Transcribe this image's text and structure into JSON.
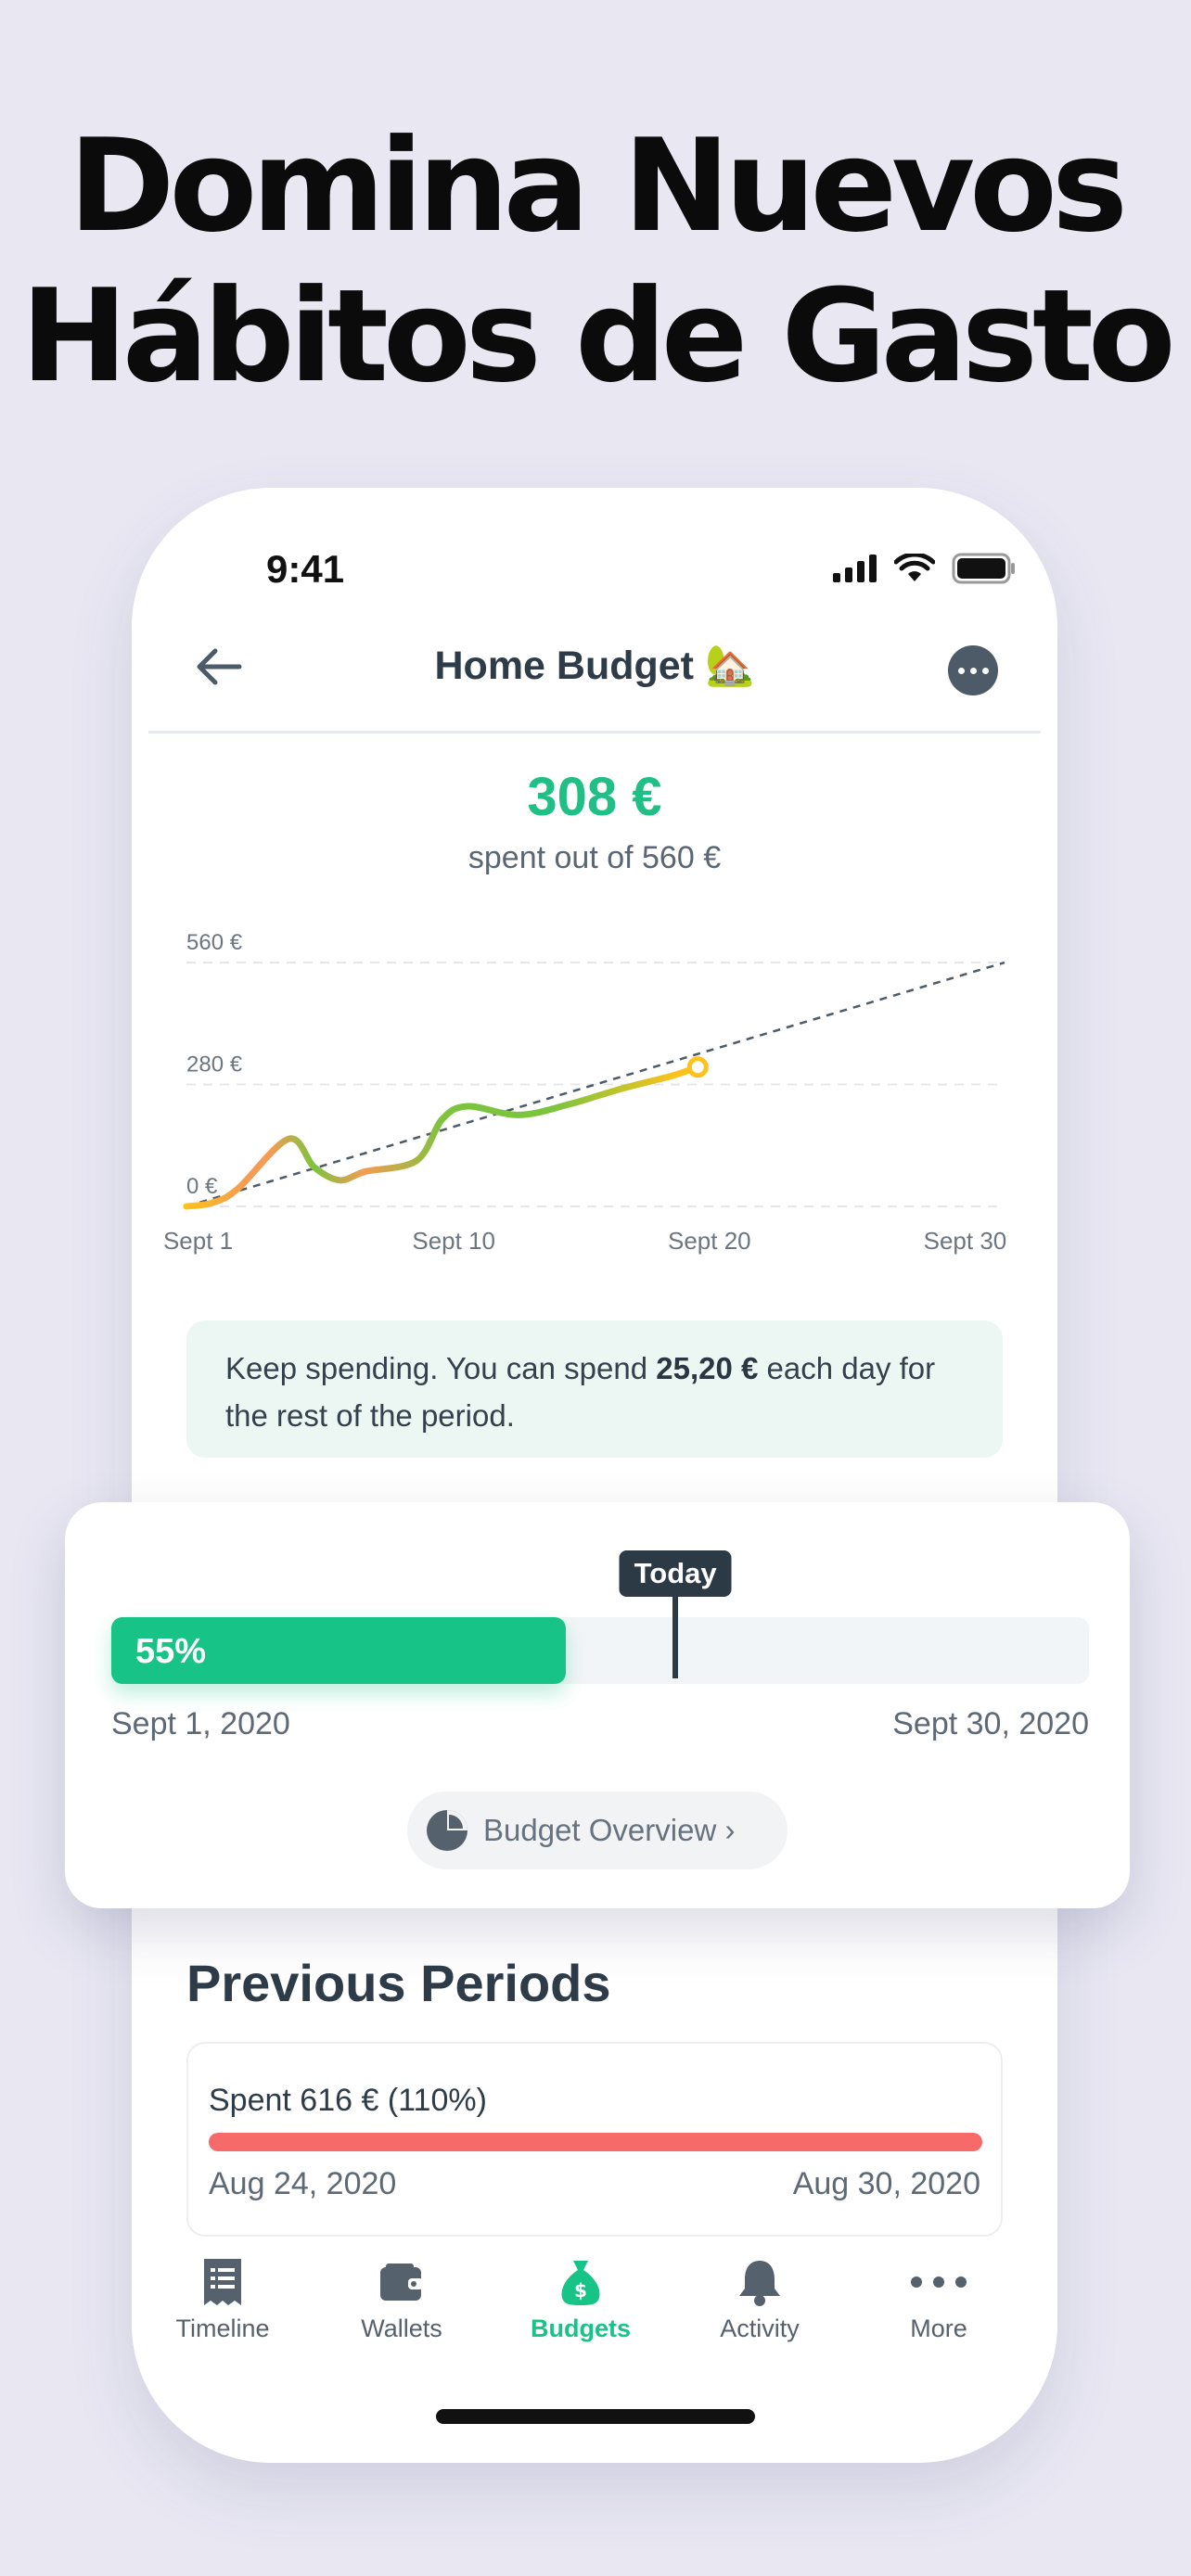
{
  "headline": {
    "line1": "Domina Nuevos",
    "line2": "Hábitos de Gasto"
  },
  "status": {
    "time": "9:41"
  },
  "nav": {
    "title": "Home Budget 🏡"
  },
  "budget": {
    "spent": "308 €",
    "subtitle": "spent out of 560 €"
  },
  "chart_data": {
    "type": "line",
    "y_tick_labels": [
      "560 €",
      "280 €",
      "0 €"
    ],
    "x_tick_labels": [
      "Sept 1",
      "Sept 10",
      "Sept 20",
      "Sept 30"
    ],
    "ylim": [
      0,
      560
    ],
    "xlim": [
      0,
      32
    ],
    "grid": true,
    "series": [
      {
        "x": [
          0,
          1,
          2,
          4,
          5,
          6,
          7,
          9,
          10,
          11,
          13,
          15,
          17,
          19,
          20
        ],
        "y": [
          0,
          8,
          40,
          155,
          90,
          60,
          80,
          105,
          200,
          230,
          210,
          235,
          270,
          300,
          320
        ]
      },
      {
        "x": [
          0,
          32
        ],
        "y": [
          0,
          560
        ]
      }
    ],
    "today_x": 20,
    "colors": {
      "line_start": "#FFC21A",
      "line_mid": "#F59B52",
      "line_good": "#7CC43E",
      "target": "#4d5b69"
    }
  },
  "tip": {
    "prefix": "Keep spending. You can spend ",
    "amount": "25,20 €",
    "suffix": " each day for the rest of the period."
  },
  "progress": {
    "percent_label": "55%",
    "fraction": 0.465,
    "today_label": "Today",
    "today_fraction": 0.577,
    "start": "Sept 1, 2020",
    "end": "Sept 30, 2020"
  },
  "overview_button": {
    "label": "Budget Overview ›"
  },
  "previous": {
    "title": "Previous Periods",
    "spent": "Spent 616 € (110%)",
    "start": "Aug 24, 2020",
    "end": "Aug 30, 2020"
  },
  "tabs": [
    {
      "label": "Timeline",
      "icon": "receipt-icon"
    },
    {
      "label": "Wallets",
      "icon": "wallet-icon"
    },
    {
      "label": "Budgets",
      "icon": "money-bag-icon",
      "active": true
    },
    {
      "label": "Activity",
      "icon": "bell-icon"
    },
    {
      "label": "More",
      "icon": "ellipsis-icon"
    }
  ]
}
